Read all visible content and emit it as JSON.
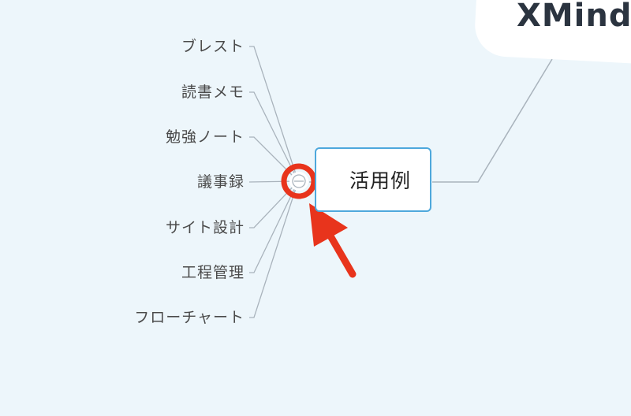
{
  "root": {
    "title": "XMind"
  },
  "main_topic": {
    "label": "活用例"
  },
  "branches": [
    {
      "label": "ブレスト"
    },
    {
      "label": "読書メモ"
    },
    {
      "label": "勉強ノート"
    },
    {
      "label": "議事録"
    },
    {
      "label": "サイト設計"
    },
    {
      "label": "工程管理"
    },
    {
      "label": "フローチャート"
    }
  ],
  "colors": {
    "background": "#edf6fb",
    "topic_border": "#4ea8dc",
    "connector": "#a9b3bc",
    "highlight": "#e8341c"
  },
  "icons": {
    "collapse_toggle": "collapse-toggle-icon",
    "annotation_arrow": "red-arrow-icon"
  }
}
